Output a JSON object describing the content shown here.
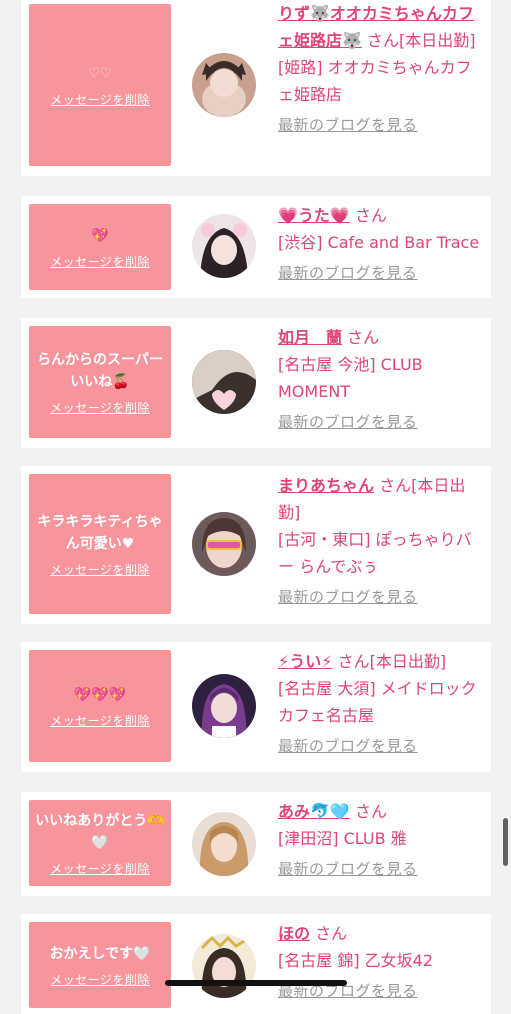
{
  "entries": [
    {
      "message": "♡♡",
      "delete_label": "メッセージを削除",
      "name": "りず🐺オオカミちゃんカフェ姫路店🐺",
      "honorific": "さん",
      "badge": "[本日出勤]",
      "shop": "[姫路] オオカミちゃんカフェ姫路店",
      "blog_label": "最新のブログを見る"
    },
    {
      "message": "💖",
      "delete_label": "メッセージを削除",
      "name": "💗うた💗",
      "honorific": "さん",
      "badge": "",
      "shop": "[渋谷] Cafe and Bar Trace",
      "blog_label": "最新のブログを見る"
    },
    {
      "message": "らんからのスーパーいいね🍒",
      "delete_label": "メッセージを削除",
      "name": "如月　蘭",
      "honorific": "さん",
      "badge": "",
      "shop": "[名古屋 今池] CLUB MOMENT",
      "blog_label": "最新のブログを見る"
    },
    {
      "message": "キラキラキティちゃん可愛い♥",
      "delete_label": "メッセージを削除",
      "name": "まりあちゃん",
      "honorific": "さん",
      "badge": "[本日出勤]",
      "shop": "[古河・東口] ぽっちゃりバー らんでぶぅ",
      "blog_label": "最新のブログを見る"
    },
    {
      "message": "💖💖💖",
      "delete_label": "メッセージを削除",
      "name": "⚡うい⚡",
      "honorific": "さん",
      "badge": "[本日出勤]",
      "shop": "[名古屋 大須] メイドロックカフェ名古屋",
      "blog_label": "最新のブログを見る"
    },
    {
      "message": "いいねありがとう🫶🤍",
      "delete_label": "メッセージを削除",
      "name": "あみ🐬🩵",
      "honorific": "さん",
      "badge": "",
      "shop": "[津田沼] CLUB 雅",
      "blog_label": "最新のブログを見る"
    },
    {
      "message": "おかえしです🤍",
      "delete_label": "メッセージを削除",
      "name": "ほの",
      "honorific": "さん",
      "badge": "",
      "shop": "[名古屋 錦] 乙女坂42",
      "blog_label": "最新のブログを見る"
    }
  ],
  "colors": {
    "accent": "#e0457a",
    "message_bg": "#f8949c",
    "link_gray": "#999999",
    "page_bg": "#f2f2f2"
  }
}
